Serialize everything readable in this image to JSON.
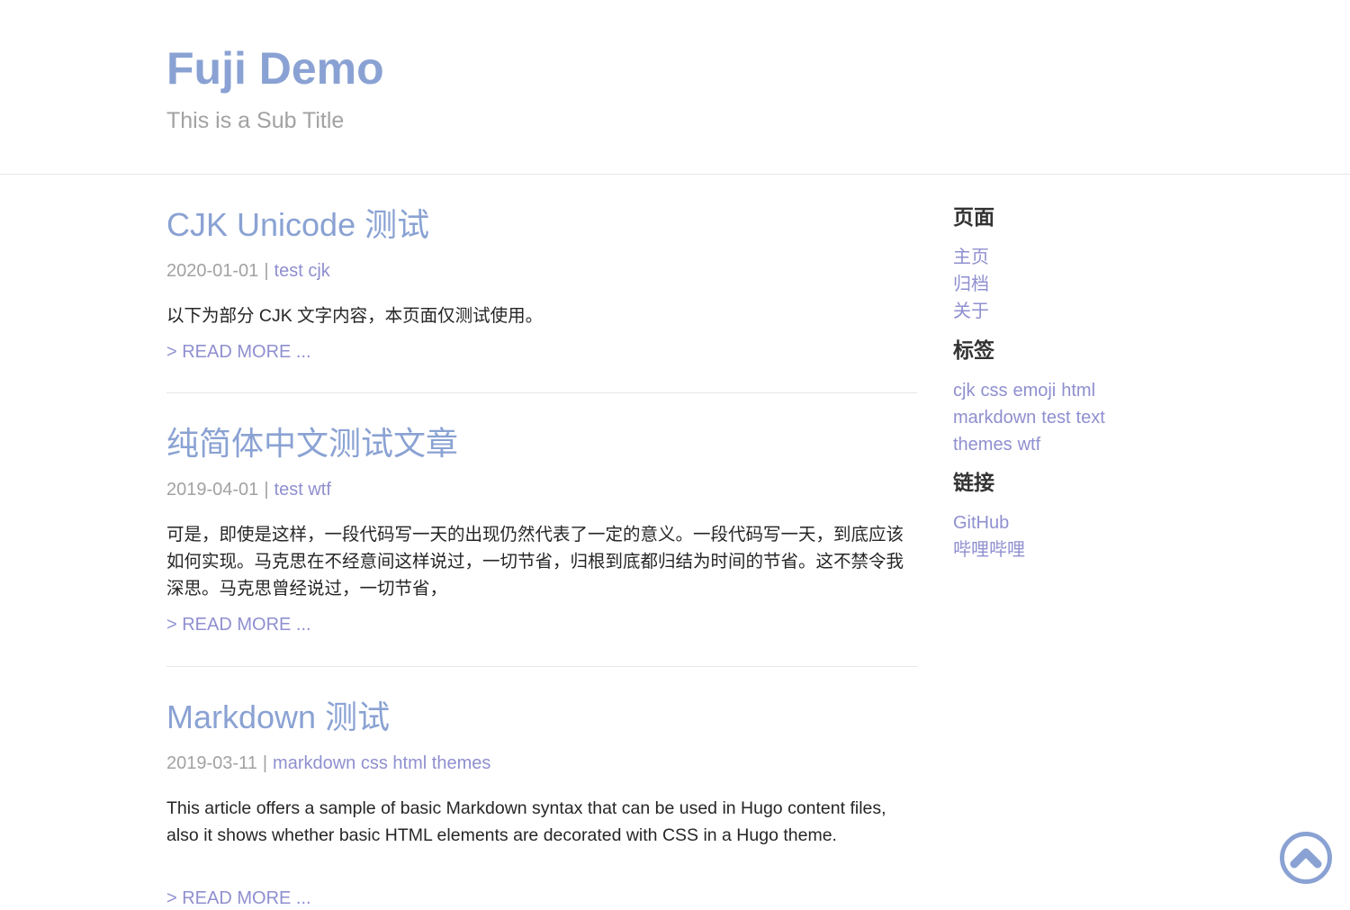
{
  "header": {
    "title": "Fuji Demo",
    "subtitle": "This is a Sub Title"
  },
  "posts": [
    {
      "title": "CJK Unicode 测试",
      "date": "2020-01-01",
      "separator": "|",
      "tags": [
        "test",
        "cjk"
      ],
      "summary": "以下为部分 CJK 文字内容，本页面仅测试使用。",
      "read_more": "> READ MORE ..."
    },
    {
      "title": "纯简体中文测试文章",
      "date": "2019-04-01",
      "separator": "|",
      "tags": [
        "test",
        "wtf"
      ],
      "summary": "可是，即使是这样，一段代码写一天的出现仍然代表了一定的意义。一段代码写一天，到底应该如何实现。马克思在不经意间这样说过，一切节省，归根到底都归结为时间的节省。这不禁令我深思。马克思曾经说过，一切节省，",
      "read_more": "> READ MORE ..."
    },
    {
      "title": "Markdown 测试",
      "date": "2019-03-11",
      "separator": "|",
      "tags": [
        "markdown",
        "css",
        "html",
        "themes"
      ],
      "summary": "This article offers a sample of basic Markdown syntax that can be used in Hugo content files, also it shows whether basic HTML elements are decorated with CSS in a Hugo theme.",
      "read_more": "> READ MORE ..."
    }
  ],
  "sidebar": {
    "pages": {
      "heading": "页面",
      "links": [
        "主页",
        "归档",
        "关于"
      ]
    },
    "tags": {
      "heading": "标签",
      "lines": [
        [
          "cjk",
          "css",
          "emoji",
          "html"
        ],
        [
          "markdown",
          "test",
          "text"
        ],
        [
          "themes",
          "wtf"
        ]
      ]
    },
    "links": {
      "heading": "链接",
      "links": [
        "GitHub",
        "哔哩哔哩"
      ]
    }
  },
  "back_to_top": {
    "icon": "chevron-up-circle-icon",
    "color": "#8aa2d3"
  },
  "colors": {
    "title": "#8aa2d3",
    "link": "#8f8fd0",
    "muted": "#a2a2a2",
    "divider": "#e6e6e6"
  }
}
